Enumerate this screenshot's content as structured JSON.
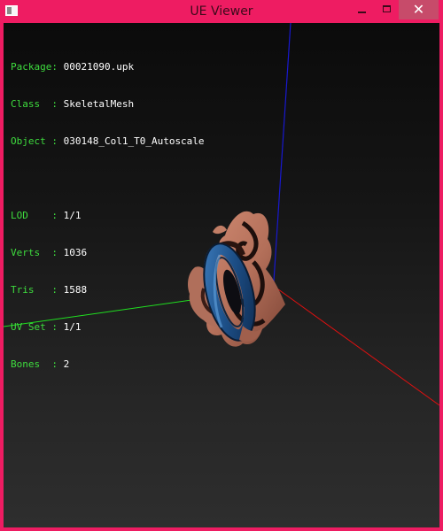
{
  "window": {
    "title": "UE Viewer",
    "close_glyph": "✕"
  },
  "info": {
    "package_label": "Package:",
    "package_value": "00021090.upk",
    "class_label": "Class  :",
    "class_value": "SkeletalMesh",
    "object_label": "Object :",
    "object_value": "030148_Col1_T0_Autoscale",
    "lod_label": "LOD    :",
    "lod_value": "1/1",
    "verts_label": "Verts  :",
    "verts_value": "1036",
    "tris_label": "Tris   :",
    "tris_value": "1588",
    "uvset_label": "UV Set :",
    "uvset_value": "1/1",
    "bones_label": "Bones  :",
    "bones_value": "2"
  },
  "colors": {
    "frame": "#ee1c62",
    "axis_x": "#e01010",
    "axis_y": "#20e020",
    "axis_z": "#1818d0",
    "label_text": "#3edc3e",
    "value_text": "#ffffff"
  },
  "icons": {
    "app": "app-icon",
    "minimize": "minimize-icon",
    "maximize": "maximize-icon",
    "close": "close-icon"
  }
}
